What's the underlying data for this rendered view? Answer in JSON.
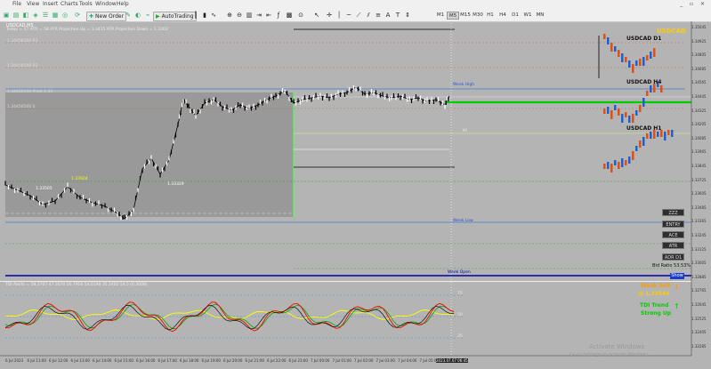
{
  "menu": [
    "File",
    "View",
    "Insert",
    "Charts",
    "Tools",
    "Window",
    "Help"
  ],
  "window_controls": "_ ▫ ✕",
  "toolbar": {
    "new_order": "New Order",
    "autotrading": "AutoTrading",
    "timeframes": [
      "M1",
      "M5",
      "M15",
      "M30",
      "H1",
      "H4",
      "D1",
      "W1",
      "MN"
    ],
    "active_timeframe": "M5"
  },
  "chart": {
    "symbol_header": "USDCAD,M5",
    "info_line": "Today = 17   ATR = 58   ATR Projection Up = 1.3415   ATR Projection Down = 1.3303",
    "hlevel_labels": [
      "1.34456500 R3",
      "1.34456500 R2",
      "1.34456500 Pivot 1.33",
      "1.34456500 S"
    ],
    "marker_labels": [
      "1.33924",
      "1.33505",
      "1.33329"
    ],
    "right_labels": {
      "week_high": "Week High",
      "week_low": "Week Low",
      "week_open": "Week Open",
      "hi": "HI"
    },
    "mini_charts": [
      {
        "label": "USDCAD D1",
        "accent": "USDCAD"
      },
      {
        "label": "USDCAD H4"
      },
      {
        "label": "USDCAD H1"
      }
    ],
    "side_buttons": [
      "ZZZ",
      "ENTRY",
      "ACE",
      "ATR",
      "ADR D1"
    ],
    "bid_ratio": "Bid Ratio 53.53%",
    "show_button": "Show",
    "indicator_header": "TDI Alerts = 58.2707  47.3070  56.7956  54.0198  35.2402  54.5  (0.3008)",
    "indicator_levels": [
      "75",
      "50",
      "25"
    ],
    "signals": {
      "weak_sell": "Weak Sell",
      "weak_sell_price": "@ 1.33546",
      "tdi_trend": "TDI Trend",
      "strong_up": "Strong Up",
      "down_arrow": "↓",
      "up_arrow": "↑"
    },
    "price_axis": [
      "1.35045",
      "1.34925",
      "1.34805",
      "1.34685",
      "1.34565",
      "1.34445",
      "1.34325",
      "1.34205",
      "1.34085",
      "1.33965",
      "1.33845",
      "1.33725",
      "1.33605",
      "1.33485",
      "1.33365",
      "1.33245",
      "1.33125",
      "1.33005",
      "1.32885",
      "1.32765",
      "1.32645",
      "1.32525",
      "1.32405",
      "1.32285"
    ],
    "time_axis": [
      "6 Jul 2023",
      "6 Jul 11:00",
      "6 Jul 12:00",
      "6 Jul 13:00",
      "6 Jul 14:00",
      "6 Jul 15:00",
      "6 Jul 16:00",
      "6 Jul 17:00",
      "6 Jul 18:00",
      "6 Jul 19:00",
      "6 Jul 20:00",
      "6 Jul 21:00",
      "6 Jul 22:00",
      "6 Jul 23:00",
      "7 Jul 00:00",
      "7 Jul 01:00",
      "7 Jul 02:00",
      "7 Jul 03:00",
      "7 Jul 04:00",
      "7 Jul 05:00",
      "2023.07.07 06:45"
    ],
    "watermark_1": "Activate Windows",
    "watermark_2": "Go to Settings to activate Windows."
  },
  "colors": {
    "up": "#ffffff",
    "down": "#000000",
    "rsi": "#ff0000",
    "signal": "#00aa00",
    "yellow": "#ffff00",
    "accent": "#ffcc00",
    "green": "#00ff00",
    "blue": "#3060ff"
  }
}
